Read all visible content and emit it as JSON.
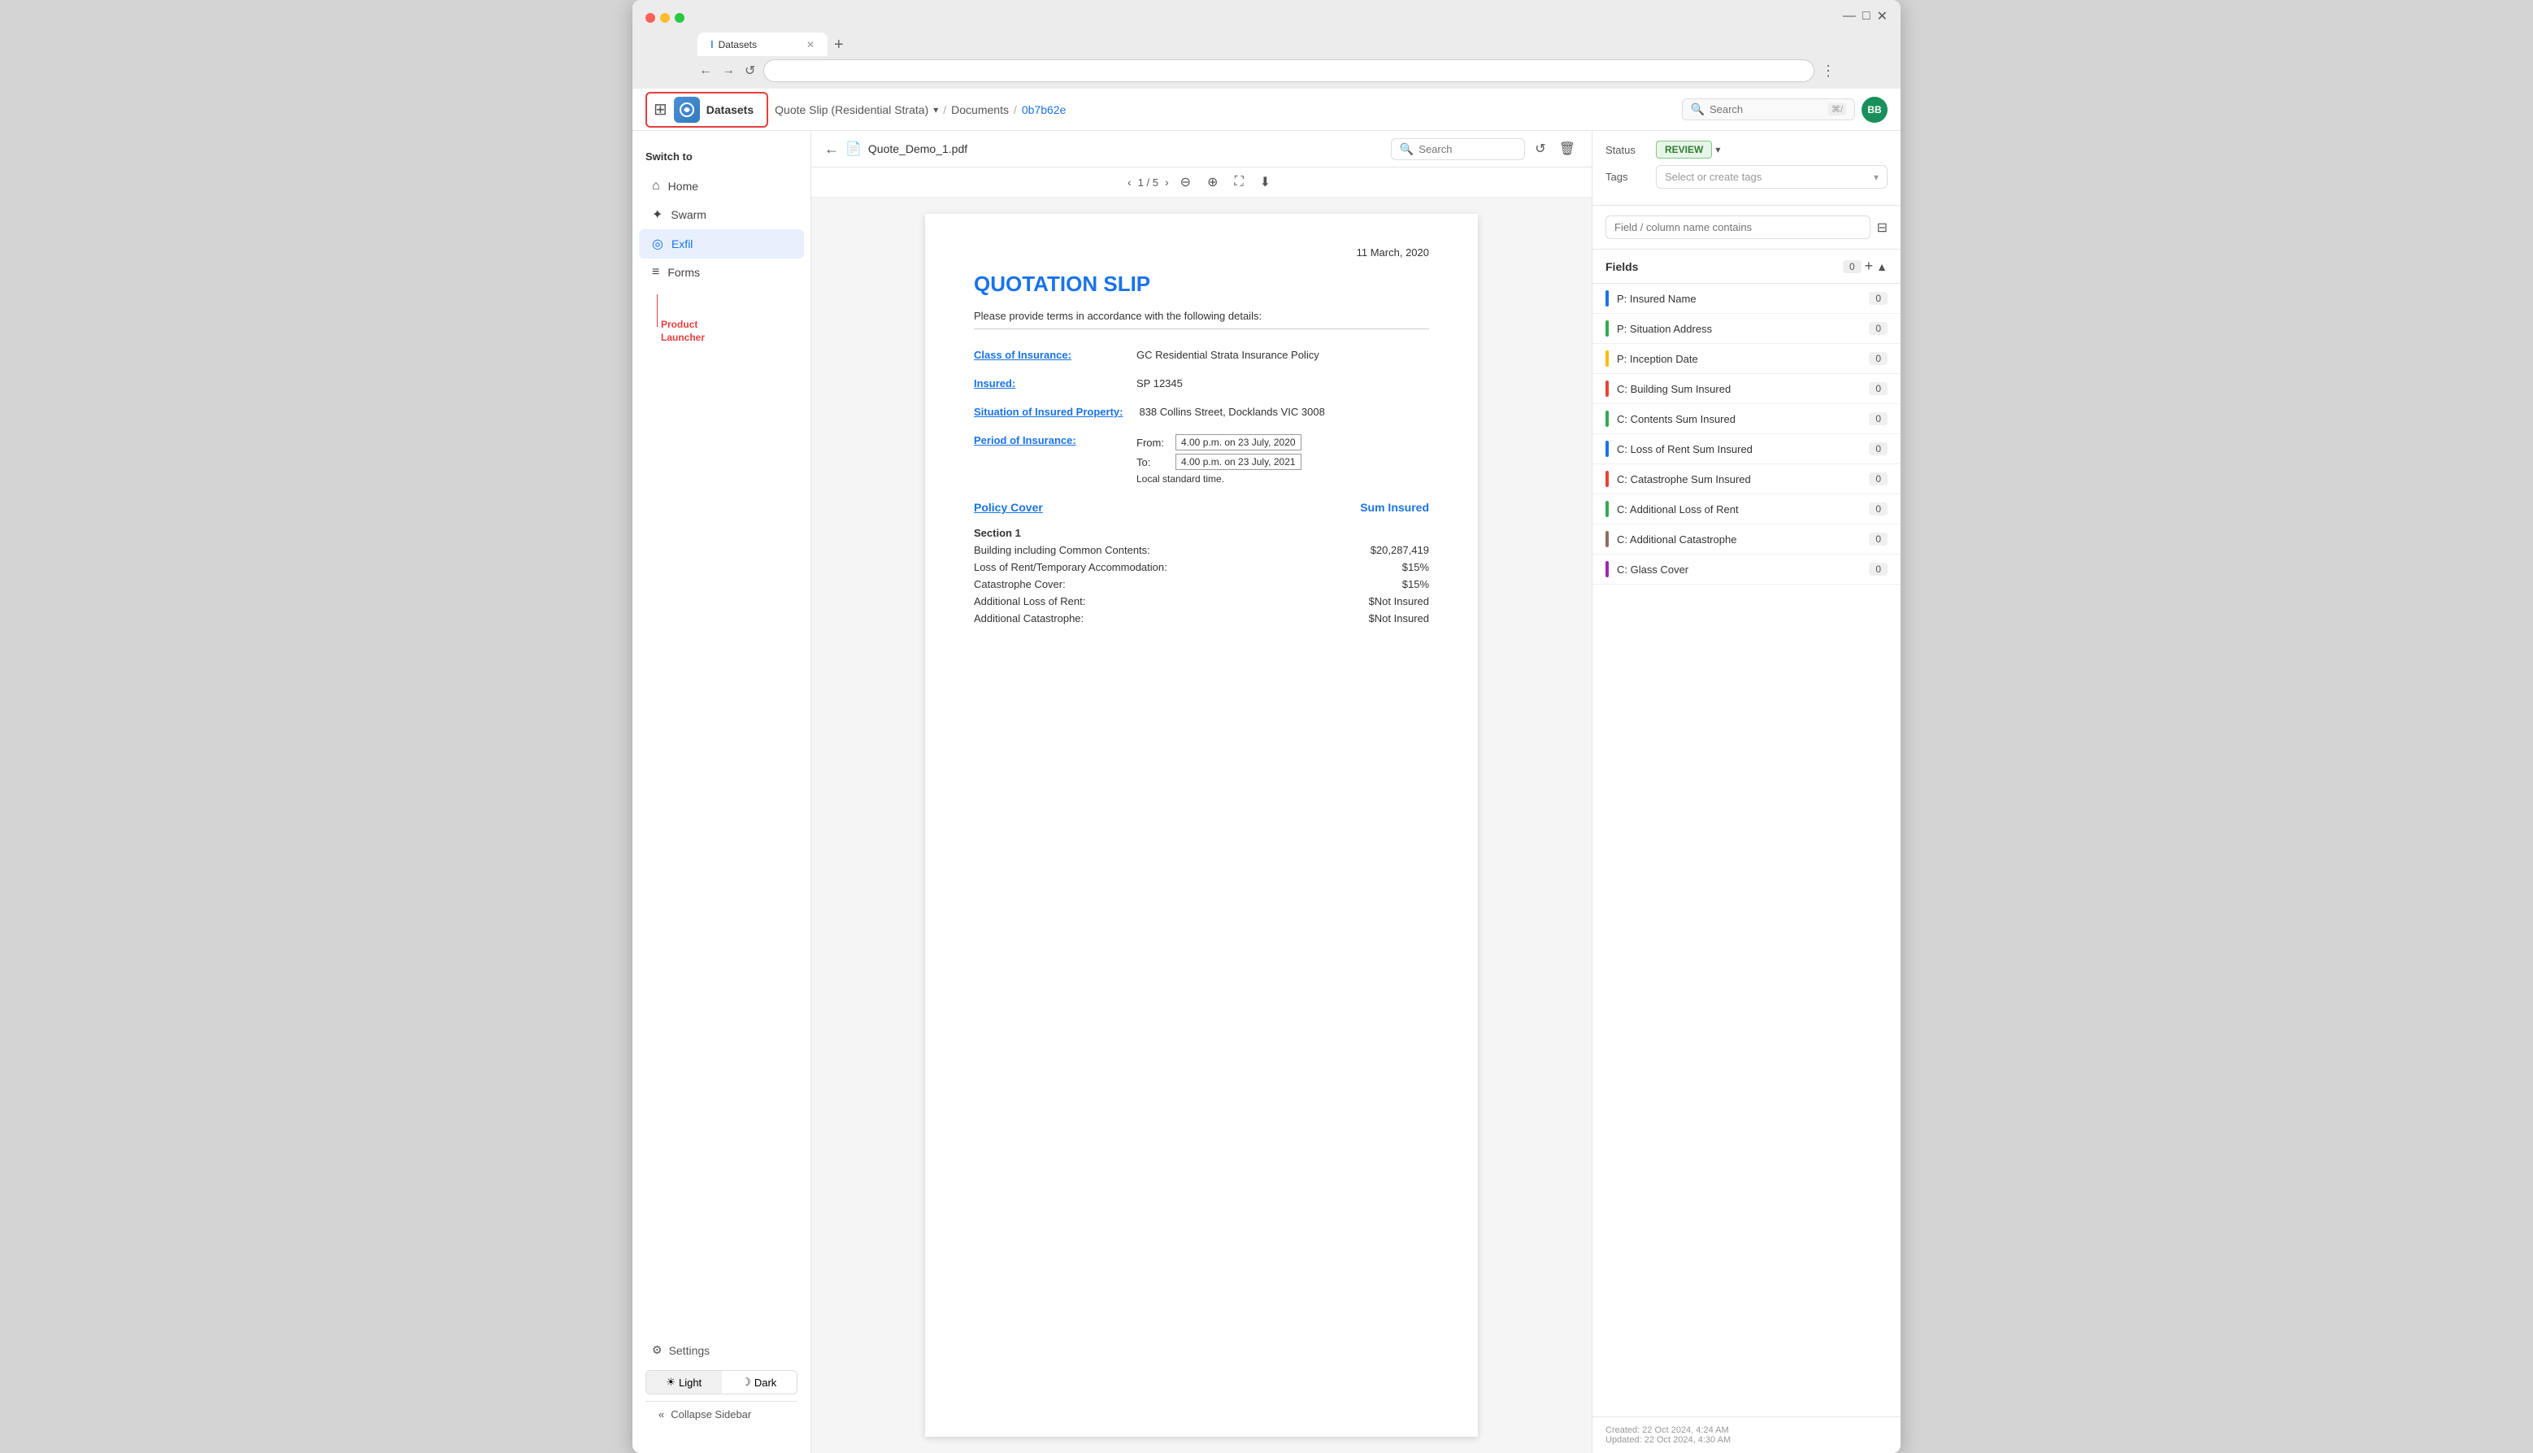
{
  "browser": {
    "tab_title": "Datasets",
    "url": "",
    "add_tab": "+",
    "nav_back": "←",
    "nav_fwd": "→",
    "nav_reload": "↺",
    "more_menu": "⋮"
  },
  "topbar": {
    "app_logo": "I",
    "datasets_label": "Datasets",
    "breadcrumb": {
      "project": "Quote Slip (Residential Strata)",
      "separator1": "/",
      "section": "Documents",
      "separator2": "/",
      "current": "0b7b62e"
    },
    "search_placeholder": "Search",
    "search_shortcut": "⌘/",
    "user_initials": "BB"
  },
  "sidebar": {
    "switch_to_label": "Switch to",
    "annotation_label": "Product\nLauncher",
    "menu_items": [
      {
        "id": "home",
        "label": "Home",
        "icon": "⌂"
      },
      {
        "id": "swarm",
        "label": "Swarm",
        "icon": "✦"
      },
      {
        "id": "exfil",
        "label": "Exfil",
        "icon": "◎",
        "active": true
      },
      {
        "id": "forms",
        "label": "Forms",
        "icon": "≡"
      }
    ],
    "settings_label": "Settings",
    "theme": {
      "light_label": "Light",
      "dark_label": "Dark",
      "light_icon": "☀",
      "dark_icon": "☽",
      "active": "light"
    },
    "collapse_label": "Collapse Sidebar"
  },
  "doc_toolbar": {
    "back": "←",
    "filename": "Quote_Demo_1.pdf",
    "search_placeholder": "Search",
    "refresh_icon": "↺",
    "delete_icon": "🗑"
  },
  "doc_pagination": {
    "prev": "‹",
    "next": "›",
    "current": "1",
    "total": "5",
    "zoom_out": "⊖",
    "zoom_in": "⊕",
    "fullscreen": "⛶",
    "download": "⬇"
  },
  "pdf_content": {
    "date": "11 March, 2020",
    "title": "QUOTATION SLIP",
    "subtitle": "Please provide terms in accordance with the following details:",
    "fields": [
      {
        "label": "Class of Insurance:",
        "value": "GC Residential Strata Insurance Policy"
      },
      {
        "label": "Insured:",
        "value": "SP 12345"
      },
      {
        "label": "Situation of Insured Property:",
        "value": "838 Collins Street, Docklands VIC 3008"
      }
    ],
    "period_label": "Period of Insurance:",
    "period_from": "4.00 p.m. on 23 July, 2020",
    "period_to": "4.00 p.m. on 23 July, 2021",
    "period_note": "Local standard time.",
    "section_header": "Policy Cover",
    "section_sum": "Sum Insured",
    "cover_rows": [
      {
        "label": "Section 1",
        "value": ""
      },
      {
        "label": "Building including Common Contents:",
        "value": "$20,287,419"
      },
      {
        "label": "Loss of Rent/Temporary Accommodation:",
        "value": "$15%"
      },
      {
        "label": "Catastrophe Cover:",
        "value": "$15%"
      },
      {
        "label": "Additional Loss of Rent:",
        "value": "$Not Insured"
      },
      {
        "label": "Additional Catastrophe:",
        "value": "$Not Insured"
      }
    ]
  },
  "right_panel": {
    "status_label": "Status",
    "status_value": "REVIEW",
    "status_dropdown_icon": "▾",
    "tags_label": "Tags",
    "tags_placeholder": "Select or create tags",
    "tags_arrow": "▾",
    "filter_placeholder": "Field / column name contains",
    "filter_icon": "⊟",
    "fields_title": "Fields",
    "fields_count": "0",
    "fields_add": "+",
    "fields_collapse": "▲",
    "field_items": [
      {
        "id": "insured-name",
        "label": "P: Insured Name",
        "color": "#1a73e8",
        "count": "0"
      },
      {
        "id": "situation-address",
        "label": "P: Situation Address",
        "color": "#34a853",
        "count": "0"
      },
      {
        "id": "inception-date",
        "label": "P: Inception Date",
        "color": "#fbbc04",
        "count": "0"
      },
      {
        "id": "building-sum-insured",
        "label": "C: Building Sum Insured",
        "color": "#ea4335",
        "count": "0"
      },
      {
        "id": "contents-sum-insured",
        "label": "C: Contents Sum Insured",
        "color": "#34a853",
        "count": "0"
      },
      {
        "id": "loss-of-rent",
        "label": "C: Loss of Rent Sum Insured",
        "color": "#1a73e8",
        "count": "0"
      },
      {
        "id": "catastrophe-sum",
        "label": "C: Catastrophe Sum Insured",
        "color": "#ea4335",
        "count": "0"
      },
      {
        "id": "additional-loss",
        "label": "C: Additional Loss of Rent",
        "color": "#34a853",
        "count": "0"
      },
      {
        "id": "additional-cat",
        "label": "C: Additional Catastrophe",
        "color": "#8d6e63",
        "count": "0"
      },
      {
        "id": "glass-cover",
        "label": "C: Glass Cover",
        "color": "#9c27b0",
        "count": "0"
      }
    ],
    "footer_created": "Created: 22 Oct 2024, 4:24 AM",
    "footer_updated": "Updated: 22 Oct 2024, 4:30 AM"
  }
}
